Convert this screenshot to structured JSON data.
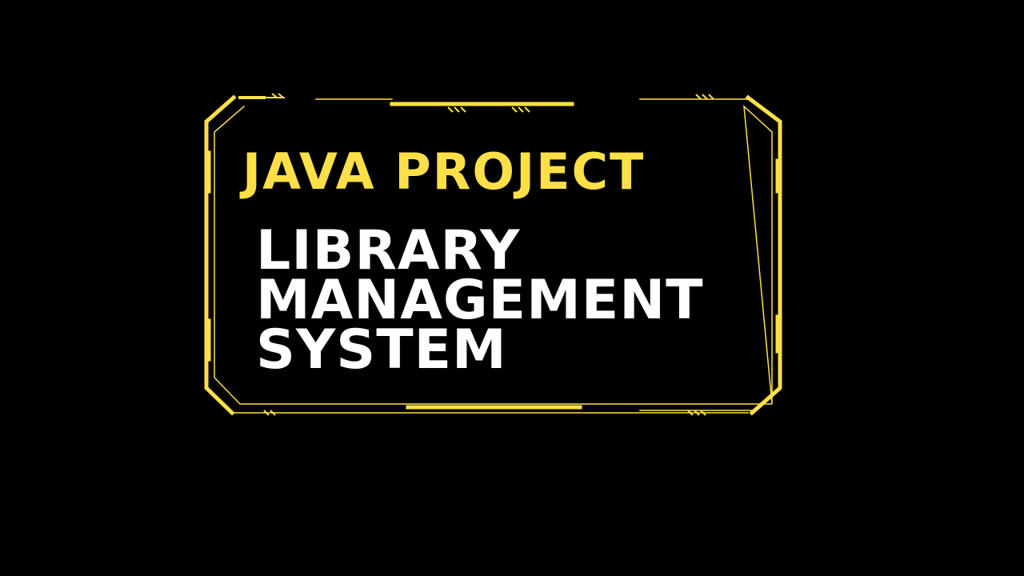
{
  "colors": {
    "background": "#000000",
    "accent": "#fde047",
    "text": "#ffffff"
  },
  "banner": {
    "heading": "JAVA PROJECT",
    "subtitle_lines": [
      "LIBRARY",
      "MANAGEMENT",
      "SYSTEM"
    ]
  },
  "decoration": {
    "frame": "tech-frame-border"
  }
}
